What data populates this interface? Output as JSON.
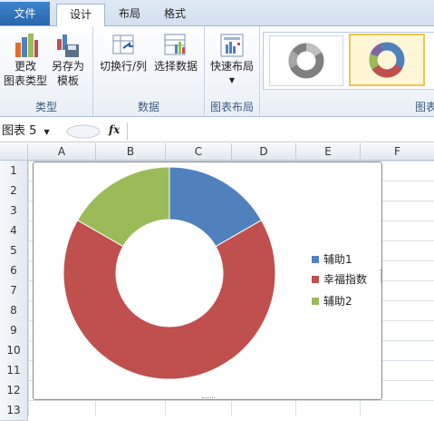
{
  "ribbon": {
    "tabs": [
      {
        "label": "文件"
      },
      {
        "label": "设计"
      },
      {
        "label": "布局"
      },
      {
        "label": "格式"
      }
    ],
    "buttons": {
      "change_type": [
        "更改",
        "图表类型"
      ],
      "save_template": [
        "另存为",
        "模板"
      ],
      "switch_row_col": "切换行/列",
      "select_data": "选择数据",
      "quick_layout": "快速布局"
    },
    "groups": {
      "type": "类型",
      "data": "数据",
      "layout": "图表布局",
      "style_partial": "图表"
    }
  },
  "formula_bar": {
    "name_box": "图表 5",
    "fx": "fx",
    "value": ""
  },
  "sheet": {
    "columns": [
      "A",
      "B",
      "C",
      "D",
      "E",
      "F"
    ],
    "rows": [
      "1",
      "2",
      "3",
      "4",
      "5",
      "6",
      "7",
      "8",
      "9",
      "10",
      "11",
      "12",
      "13"
    ]
  },
  "colors": {
    "series1": "#4f81bd",
    "series2": "#c0504d",
    "series3": "#9bbb59",
    "selection": "#f2c44b"
  },
  "chart_data": {
    "type": "doughnut",
    "title": "",
    "categories": [
      "辅助1",
      "幸福指数",
      "辅助2"
    ],
    "values": [
      16.7,
      66.6,
      16.7
    ],
    "legend": "right"
  }
}
